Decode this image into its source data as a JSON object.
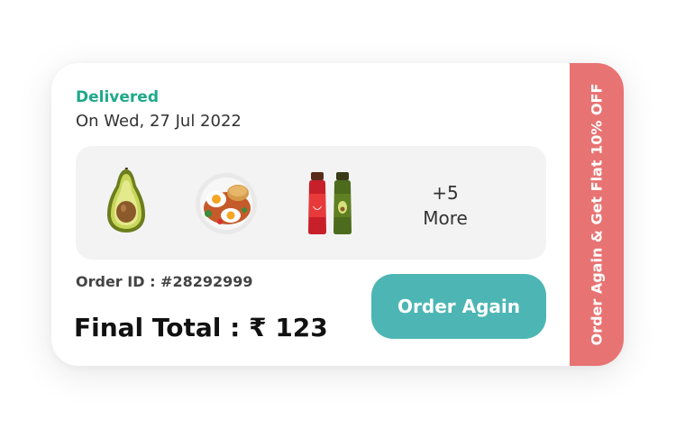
{
  "order": {
    "status": "Delivered",
    "date": "On Wed, 27 Jul 2022",
    "items": [
      {
        "name": "avocado"
      },
      {
        "name": "breakfast-plate"
      },
      {
        "name": "juice-bottles"
      }
    ],
    "more_count": "+5",
    "more_label": "More",
    "order_id": "Order ID : #28292999",
    "final_total": "Final Total : ₹ 123"
  },
  "actions": {
    "order_again_label": "Order Again"
  },
  "offer": {
    "text": "Order Again & Get Flat 10% OFF"
  },
  "colors": {
    "status_green": "#1fa88a",
    "button_teal": "#4db6b4",
    "offer_red": "#e87373",
    "panel_gray": "#f3f3f3"
  }
}
